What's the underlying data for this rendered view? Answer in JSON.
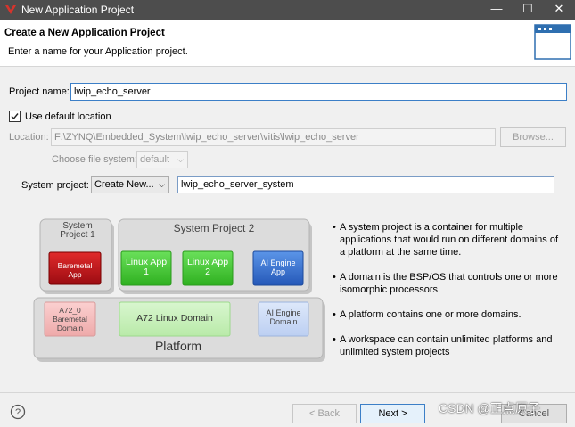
{
  "window": {
    "title": "New Application Project",
    "minimize": "—",
    "maximize": "☐",
    "close": "✕"
  },
  "header": {
    "title": "Create a New Application Project",
    "description": "Enter a name for your Application project."
  },
  "form": {
    "project_name_label": "Project name:",
    "project_name_value": "lwip_echo_server",
    "use_default_location_label": "Use default location",
    "use_default_location_checked": true,
    "location_label": "Location:",
    "location_value": "F:\\ZYNQ\\Embedded_System\\lwip_echo_server\\vitis\\lwip_echo_server",
    "browse_label": "Browse...",
    "file_system_label": "Choose file system:",
    "file_system_value": "default",
    "system_project_label": "System project:",
    "system_project_value": "Create New...",
    "system_project_name_value": "lwip_echo_server_system"
  },
  "diagram": {
    "system_project_1": "System Project 1",
    "system_project_2": "System Project 2",
    "baremetal_app": "Baremetal App",
    "linux_app_1": "Linux App 1",
    "linux_app_2": "Linux App 2",
    "ai_engine_app": "AI Engine App",
    "a72_baremetal_domain": "A72_0 Baremetal Domain",
    "a72_linux_domain": "A72 Linux Domain",
    "ai_engine_domain": "AI Engine Domain",
    "platform": "Platform"
  },
  "notes": [
    "A system project is a container for multiple applications that would run on different domains of a platform at the same time.",
    "A domain is the BSP/OS that controls one or more isomorphic processors.",
    "A platform contains one or more domains.",
    "A workspace can contain unlimited platforms and unlimited system projects"
  ],
  "buttons": {
    "back": "< Back",
    "next": "Next >",
    "cancel": "Cancel"
  },
  "watermark": "CSDN @正点原子",
  "colors": {
    "titlebar": "#4d4d4d",
    "baremetal": "#c0141c",
    "linux": "#3fcc2f",
    "ai_engine": "#2f6fd0"
  }
}
